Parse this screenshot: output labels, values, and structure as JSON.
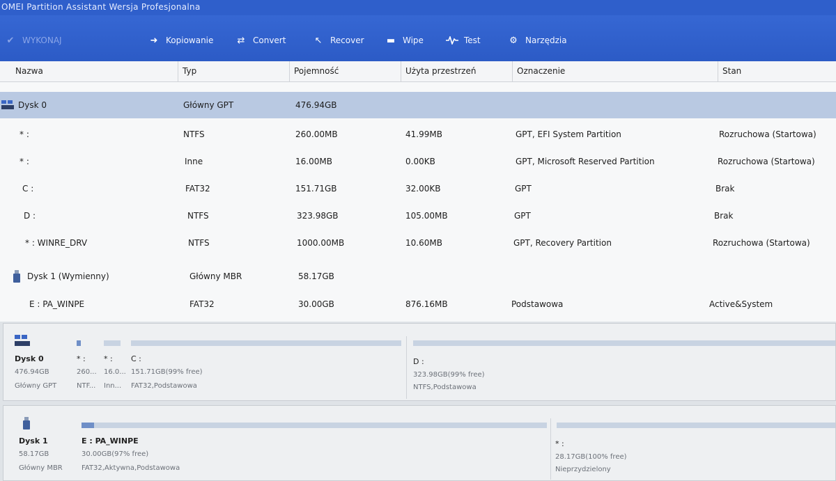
{
  "app": {
    "title": "OMEI Partition Assistant Wersja Profesjonalna"
  },
  "toolbar": {
    "buttons": [
      {
        "label": "WYKONAJ",
        "icon": "check-icon",
        "disabled": true
      },
      {
        "label": "Kopiowanie",
        "icon": "arrow-right-icon"
      },
      {
        "label": "Convert",
        "icon": "convert-icon"
      },
      {
        "label": "Recover",
        "icon": "recover-icon"
      },
      {
        "label": "Wipe",
        "icon": "wipe-icon"
      },
      {
        "label": "Test",
        "icon": "pulse-icon"
      },
      {
        "label": "Narzędzia",
        "icon": "tools-icon"
      }
    ]
  },
  "columns": [
    "Nazwa",
    "Typ",
    "Pojemność",
    "Użyta przestrzeń",
    "Oznaczenie",
    "Stan"
  ],
  "rows": [
    {
      "kind": "disk",
      "name": "Dysk 0",
      "type": "Główny GPT",
      "capacity": "476.94GB",
      "used": "",
      "label": "",
      "status": ""
    },
    {
      "kind": "part",
      "name": "* :",
      "type": "NTFS",
      "capacity": "260.00MB",
      "used": "41.99MB",
      "label": "GPT, EFI System Partition",
      "status": "Rozruchowa (Startowa)"
    },
    {
      "kind": "part",
      "name": "* :",
      "type": "Inne",
      "capacity": "16.00MB",
      "used": "0.00KB",
      "label": "GPT, Microsoft Reserved Partition",
      "status": "Rozruchowa (Startowa)"
    },
    {
      "kind": "part",
      "name": "C :",
      "type": "FAT32",
      "capacity": "151.71GB",
      "used": "32.00KB",
      "label": "GPT",
      "status": "Brak"
    },
    {
      "kind": "part",
      "name": "D :",
      "type": "NTFS",
      "capacity": "323.98GB",
      "used": "105.00MB",
      "label": "GPT",
      "status": "Brak"
    },
    {
      "kind": "part",
      "name": "* : WINRE_DRV",
      "type": "NTFS",
      "capacity": "1000.00MB",
      "used": "10.60MB",
      "label": "GPT, Recovery Partition",
      "status": "Rozruchowa (Startowa)"
    },
    {
      "kind": "usb",
      "name": "Dysk 1 (Wymienny)",
      "type": "Główny MBR",
      "capacity": "58.17GB",
      "used": "",
      "label": "",
      "status": ""
    },
    {
      "kind": "part",
      "name": "E : PA_WINPE",
      "type": "FAT32",
      "capacity": "30.00GB",
      "used": "876.16MB",
      "label": "Podstawowa",
      "status": "Active&System"
    }
  ],
  "map": {
    "disk0": {
      "name": "Dysk 0",
      "size": "476.94GB",
      "scheme": "Główny GPT",
      "parts": [
        {
          "name": "* :",
          "size": "260...",
          "fs": "NTF..."
        },
        {
          "name": "* :",
          "size": "16.0...",
          "fs": "Inn..."
        },
        {
          "name": "C :",
          "size": "151.71GB(99% free)",
          "fs": "FAT32,Podstawowa"
        },
        {
          "name": "D :",
          "size": "323.98GB(99% free)",
          "fs": "NTFS,Podstawowa"
        }
      ]
    },
    "disk1": {
      "name": "Dysk 1",
      "size": "58.17GB",
      "scheme": "Główny MBR",
      "parts": [
        {
          "name": "E : PA_WINPE",
          "size": "30.00GB(97% free)",
          "fs": "FAT32,Aktywna,Podstawowa"
        },
        {
          "name": "* :",
          "size": "28.17GB(100% free)",
          "fs": "Nieprzydzielony"
        }
      ]
    }
  }
}
